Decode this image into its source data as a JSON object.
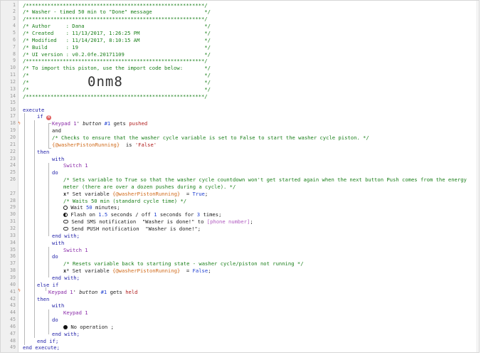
{
  "editor": {
    "line_numbers": [
      "1",
      "2",
      "3",
      "4",
      "5",
      "6",
      "7",
      "8",
      "9",
      "10",
      "11",
      "12",
      "13",
      "14",
      "15",
      "16",
      "17",
      "18",
      "19",
      "20",
      "21",
      "22",
      "23",
      "24",
      "25",
      "26",
      "27",
      "28",
      "29",
      "30",
      "31",
      "32",
      "33",
      "34",
      "35",
      "36",
      "37",
      "38",
      "39",
      "40",
      "41",
      "42",
      "43",
      "44",
      "45",
      "46",
      "47",
      "48",
      "49"
    ],
    "header": {
      "l1": "/**********************************************************/",
      "l2": "/* Washer - timed 50 min to \"Done\" message                 */",
      "l3": "/**********************************************************/",
      "l4": "/* Author     : Dana                                       */",
      "l5": "/* Created    : 11/13/2017, 1:26:25 PM                     */",
      "l6": "/* Modified   : 11/14/2017, 8:10:15 AM                     */",
      "l7": "/* Build      : 19                                         */",
      "l8": "/* UI version : v0.2.0fe.20171109                          */",
      "l9": "/**********************************************************/",
      "l10": "/* To import this piston, use the import code below:       */",
      "l11": "/*                                                         */",
      "l12": "/*                                                         */",
      "l13": "/*                                                         */",
      "l14": "/**********************************************************/",
      "import_code": "0nm8"
    },
    "kw": {
      "execute": "execute",
      "if": "if",
      "and": "and",
      "is": "is",
      "then": "then",
      "with": "with",
      "do": "do",
      "set_variable": "Set variable",
      "eq": "=",
      "semicolon": ";",
      "wait": "Wait",
      "minutes": "minutes",
      "flash_on": "Flash on",
      "seconds_off": "seconds / off",
      "seconds_for": "seconds for",
      "times": "times",
      "send_sms": "Send SMS notification",
      "to": "to",
      "send_push": "Send PUSH notification",
      "end_with": "end with;",
      "else_if": "else if",
      "gets": "gets",
      "no_operation": "No operation",
      "end_if": "end if;",
      "end_execute": "end execute;",
      "badge": "N"
    },
    "devices": {
      "keypad": "Keypad 1",
      "button": "' button",
      "switch": "Switch 1"
    },
    "values": {
      "hash1": "#1",
      "pushed": "pushed",
      "held": "held",
      "var": "{@washerPistonRunning}",
      "false_str": "'False'",
      "true_val": "True",
      "false_val": "False",
      "fifty": "50",
      "flash_on": "1.5",
      "flash_off": "1",
      "flash_times": "3",
      "sms_msg": "\"Washer is done!\"",
      "phone": "[phone number]",
      "push_msg": "\"Washer is done!\""
    },
    "comments": {
      "c20": "/* Checks to ensure that the washer cycle variable is set to False to start the washer cycle piston. */",
      "c26a": "/* Sets variable to True so that the washer cycle countdown won't get started again when the next button Push comes from the energy",
      "c26b": "meter (there are over a dozen pushes during a cycle). */",
      "c28": "/* Waits 50 min (standard cycle time) */",
      "c37": "/* Resets variable back to starting state - washer cycle/piston not running */"
    }
  }
}
